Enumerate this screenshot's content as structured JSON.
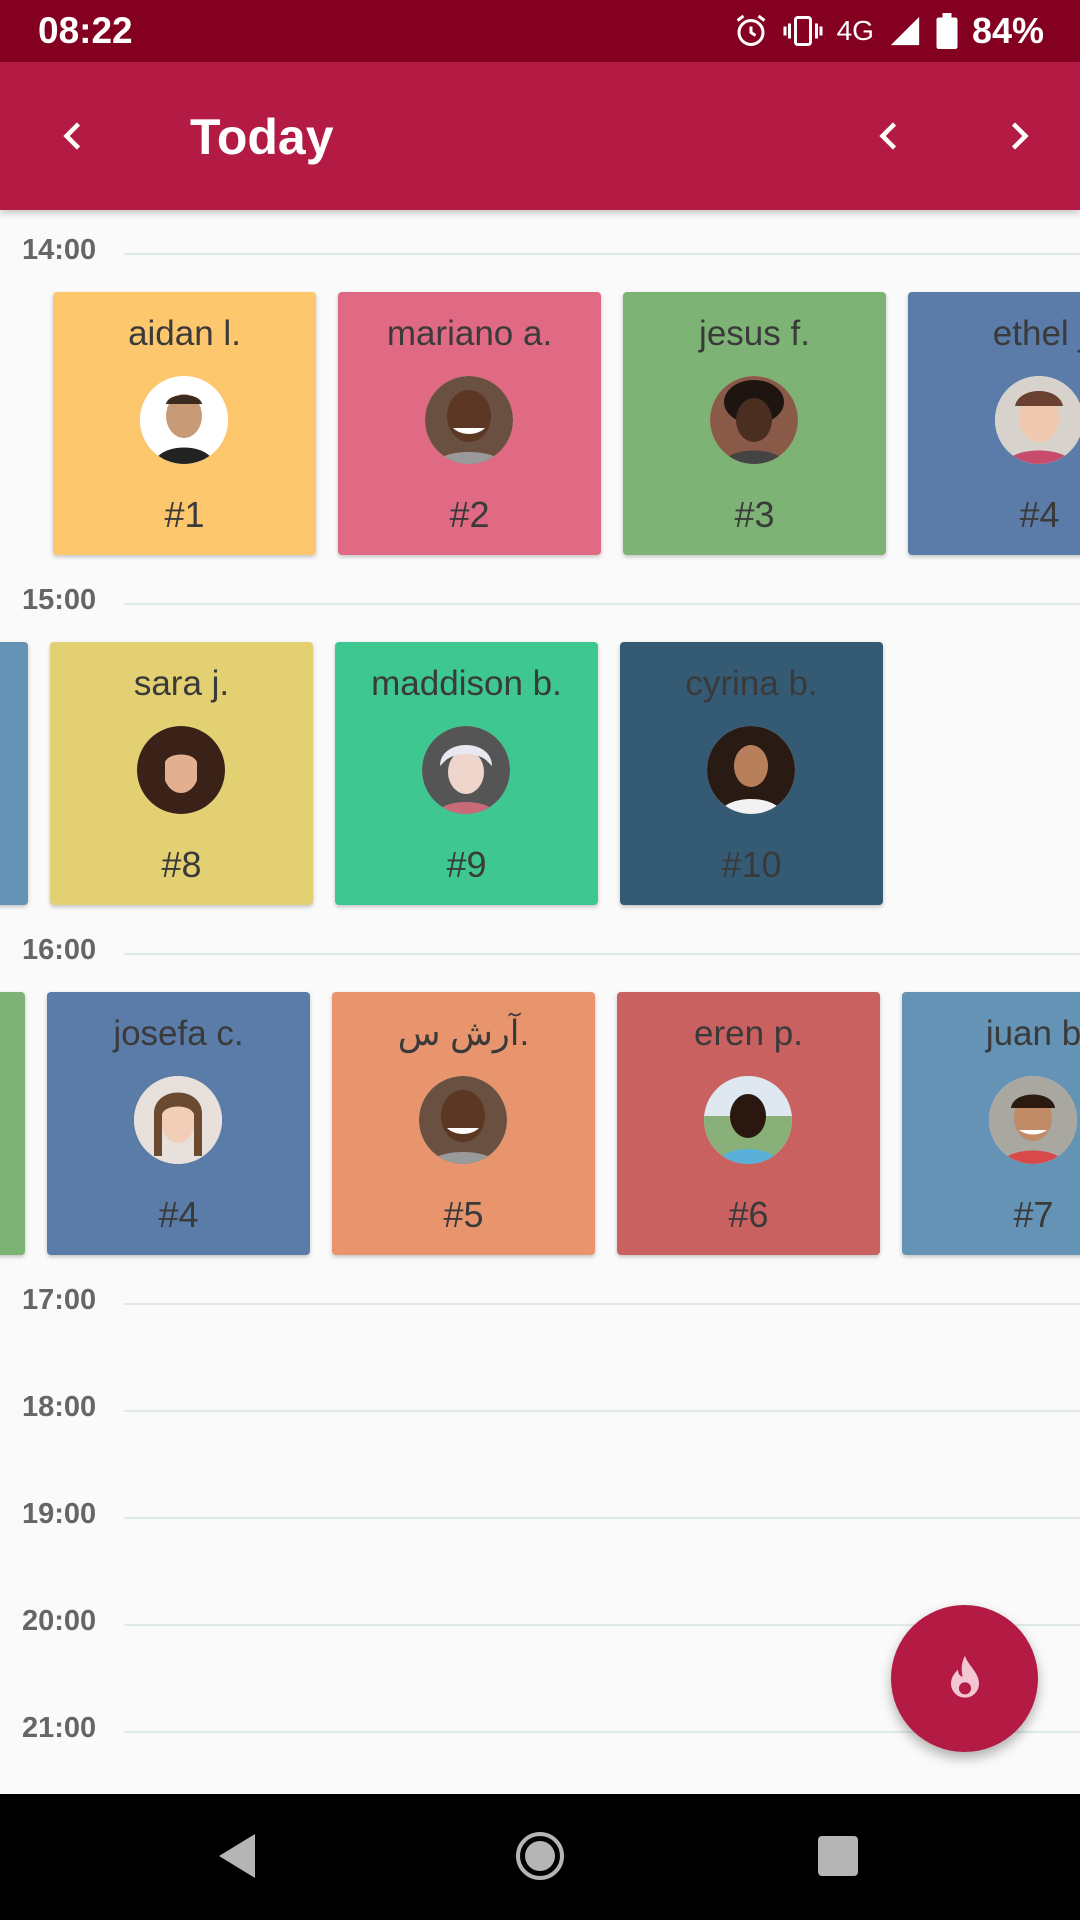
{
  "status_bar": {
    "time": "08:22",
    "network": "4G",
    "battery": "84%"
  },
  "app_bar": {
    "title": "Today",
    "back_icon": "chevron-left-icon",
    "prev_icon": "chevron-left-icon",
    "next_icon": "chevron-right-icon"
  },
  "hours": [
    "14:00",
    "15:00",
    "16:00",
    "17:00",
    "18:00",
    "19:00",
    "20:00",
    "21:00"
  ],
  "cards": {
    "row1": [
      {
        "name": "aidan l.",
        "number": "#1",
        "color": "#fdc76d"
      },
      {
        "name": "mariano a.",
        "number": "#2",
        "color": "#e06a84"
      },
      {
        "name": "jesus f.",
        "number": "#3",
        "color": "#7db374"
      },
      {
        "name": "ethel j",
        "number": "#4",
        "color": "#5b7ba8"
      }
    ],
    "row2": [
      {
        "color": "#6593b5"
      },
      {
        "name": "sara j.",
        "number": "#8",
        "color": "#e3d073"
      },
      {
        "name": "maddison b.",
        "number": "#9",
        "color": "#3ec790"
      },
      {
        "name": "cyrina b.",
        "number": "#10",
        "color": "#355a74"
      }
    ],
    "row3": [
      {
        "color": "#7db374"
      },
      {
        "name": "josefa c.",
        "number": "#4",
        "color": "#5b7ba8"
      },
      {
        "name": "آرش س.",
        "number": "#5",
        "color": "#e8956e"
      },
      {
        "name": "eren p.",
        "number": "#6",
        "color": "#c96161"
      },
      {
        "name": "juan b",
        "number": "#7",
        "color": "#6593b5"
      }
    ]
  },
  "fab": {
    "icon": "flame-icon",
    "color": "#b31b44"
  },
  "colors": {
    "status_bar": "#840021",
    "app_bar": "#b31b44"
  }
}
